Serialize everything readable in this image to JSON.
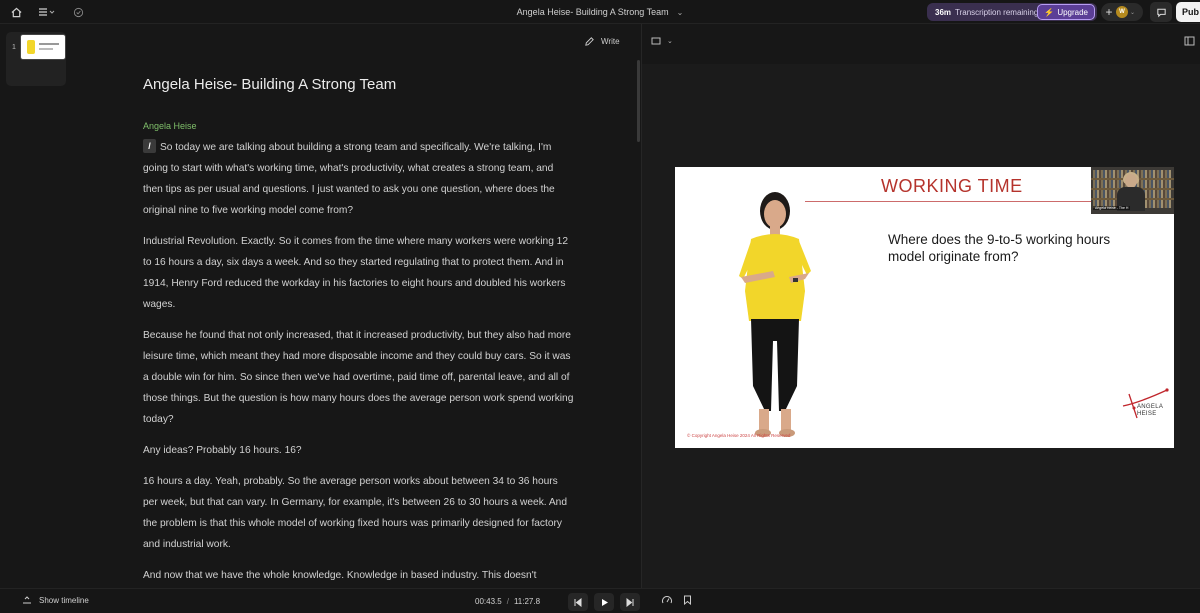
{
  "topbar": {
    "document_title": "Angela Heise- Building A Strong Team",
    "transcription_minutes": "36m",
    "transcription_label": "Transcription remaining",
    "upgrade_label": "Upgrade",
    "avatar_initial": "W",
    "publish_label": "Pub"
  },
  "toolbar": {
    "scene_number": "1",
    "write_label": "Write"
  },
  "script": {
    "title": "Angela Heise- Building A Strong Team",
    "speaker": "Angela Heise",
    "slash_label": "/",
    "paragraphs": [
      "So today we are talking about building a strong team and specifically. We're talking, I'm going to start with what's working time, what's productivity, what creates a strong team, and then tips as per usual and questions. I just wanted to ask you one question, where does the original nine to five working model come from?",
      "Industrial Revolution. Exactly. So it comes from the time where many workers were working 12 to 16 hours a day, six days a week. And so they started regulating that to protect them. And in 1914, Henry Ford reduced the workday in his factories to eight hours and doubled his workers wages.",
      "Because he found that not only increased, that it increased productivity, but they also had more leisure time, which meant they had more disposable income and they could buy cars. So it was a double win for him. So since then we've had overtime, paid time off, parental leave, and all of those things. But the question is how many hours does the average person work spend working today?",
      "Any ideas? Probably 16 hours. 16?",
      "16 hours a day. Yeah, probably. So the average person works about between 34 to 36 hours per week, but that can vary. In Germany, for example, it's between 26 to 30 hours a week. And the problem is that this whole model of working fixed hours was primarily designed for factory and industrial work.",
      "And now that we have the whole knowledge. Knowledge in based industry. This doesn't"
    ]
  },
  "slide": {
    "title": "WORKING TIME",
    "question": "Where does the 9-to-5 working hours model originate from?",
    "footer": "© Copyright Angela Heise 2024 All Rights Reserved",
    "logo_line1": "ANGELA",
    "logo_line2": "HEISE",
    "webcam_label": "Angela Heise - The H"
  },
  "playback": {
    "current_time": "00:43.5",
    "separator": "/",
    "total_time": "11:27.8",
    "show_timeline_label": "Show timeline"
  },
  "colors": {
    "accent_purple": "#5b3e96",
    "speaker_green": "#7fbf6a",
    "slide_title_red": "#b5332c",
    "shirt_yellow": "#f2d62a"
  }
}
